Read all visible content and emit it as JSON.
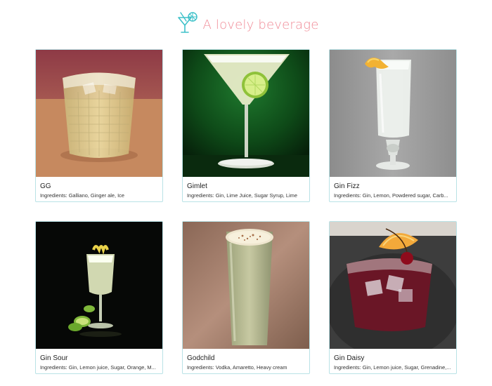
{
  "header": {
    "title": "A lovely beverage",
    "logo_icon": "cocktail-glass-icon",
    "title_color": "#f08a96",
    "icon_color": "#3ec1c9"
  },
  "drinks": [
    {
      "name": "GG",
      "ingredients_label": "Ingredients:",
      "ingredients": "Galliano, Ginger ale, Ice"
    },
    {
      "name": "Gimlet",
      "ingredients_label": "Ingredients:",
      "ingredients": "Gin, Lime Juice, Sugar Syrup, Lime"
    },
    {
      "name": "Gin Fizz",
      "ingredients_label": "Ingredients:",
      "ingredients": "Gin, Lemon, Powdered sugar, Carb..."
    },
    {
      "name": "Gin Sour",
      "ingredients_label": "Ingredients:",
      "ingredients": "Gin, Lemon juice, Sugar, Orange, M..."
    },
    {
      "name": "Godchild",
      "ingredients_label": "Ingredients:",
      "ingredients": "Vodka, Amaretto, Heavy cream"
    },
    {
      "name": "Gin Daisy",
      "ingredients_label": "Ingredients:",
      "ingredients": "Gin, Lemon juice, Sugar, Grenadine,..."
    }
  ],
  "colors": {
    "card_border": "#b9e2e6"
  }
}
